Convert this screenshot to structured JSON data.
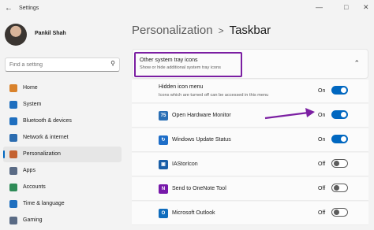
{
  "window": {
    "title": "Settings",
    "back_icon": "arrow-left-icon"
  },
  "user": {
    "name": "Pankil Shah"
  },
  "search": {
    "placeholder": "Find a setting"
  },
  "sidebar": {
    "items": [
      {
        "label": "Home",
        "icon": "home-icon",
        "color": "#d9822b",
        "active": false
      },
      {
        "label": "System",
        "icon": "monitor-icon",
        "color": "#1f6fbf",
        "active": false
      },
      {
        "label": "Bluetooth & devices",
        "icon": "bluetooth-icon",
        "color": "#1f6fbf",
        "active": false
      },
      {
        "label": "Network & internet",
        "icon": "wifi-icon",
        "color": "#2b6cb0",
        "active": false
      },
      {
        "label": "Personalization",
        "icon": "brush-icon",
        "color": "#c4612f",
        "active": true
      },
      {
        "label": "Apps",
        "icon": "apps-icon",
        "color": "#5a6b85",
        "active": false
      },
      {
        "label": "Accounts",
        "icon": "person-icon",
        "color": "#2e8b57",
        "active": false
      },
      {
        "label": "Time & language",
        "icon": "globe-clock-icon",
        "color": "#1f6fbf",
        "active": false
      },
      {
        "label": "Gaming",
        "icon": "gamepad-icon",
        "color": "#5a6b85",
        "active": false
      }
    ]
  },
  "breadcrumb": {
    "parent": "Personalization",
    "separator": ">",
    "current": "Taskbar"
  },
  "section": {
    "title": "Other system tray icons",
    "subtitle": "Show or hide additional system tray icons"
  },
  "hidden_menu": {
    "title": "Hidden icon menu",
    "subtitle": "Icons which are turned off can be accessed in this menu",
    "state": "On"
  },
  "tray_items": [
    {
      "label": "Open Hardware Monitor",
      "state": "On",
      "icon": "hardware-monitor-icon",
      "icon_color": "#2a6fb5",
      "glyph": "75"
    },
    {
      "label": "Windows Update Status",
      "state": "On",
      "icon": "windows-update-icon",
      "icon_color": "#1e6ec8",
      "glyph": "↻"
    },
    {
      "label": "IAStorIcon",
      "state": "Off",
      "icon": "iastor-icon",
      "icon_color": "#1b5fa8",
      "glyph": "▣"
    },
    {
      "label": "Send to OneNote Tool",
      "state": "Off",
      "icon": "onenote-icon",
      "icon_color": "#7719aa",
      "glyph": "N"
    },
    {
      "label": "Microsoft Outlook",
      "state": "Off",
      "icon": "outlook-icon",
      "icon_color": "#0f6cbd",
      "glyph": "O"
    }
  ],
  "colors": {
    "accent": "#0067c0",
    "highlight_box": "#7b1fa2",
    "arrow": "#7b1fa2"
  }
}
